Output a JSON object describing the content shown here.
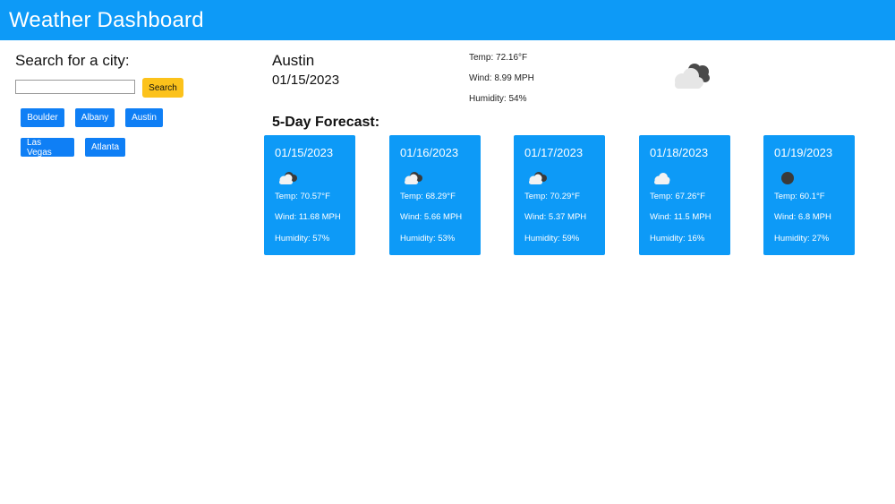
{
  "header": {
    "title": "Weather Dashboard"
  },
  "search": {
    "heading": "Search for a city:",
    "input_value": "",
    "button_label": "Search",
    "history": [
      "Boulder",
      "Albany",
      "Austin",
      "Las Vegas",
      "Atlanta"
    ]
  },
  "current": {
    "city": "Austin",
    "date": "01/15/2023",
    "temp": "Temp: 72.16°F",
    "wind": "Wind: 8.99 MPH",
    "humidity": "Humidity: 54%",
    "icon": "broken-clouds-icon"
  },
  "forecast": {
    "heading": "5-Day Forecast:",
    "days": [
      {
        "date": "01/15/2023",
        "icon": "partly-cloudy-icon",
        "temp": "Temp: 70.57°F",
        "wind": "Wind: 11.68 MPH",
        "humidity": "Humidity: 57%"
      },
      {
        "date": "01/16/2023",
        "icon": "partly-cloudy-icon",
        "temp": "Temp: 68.29°F",
        "wind": "Wind: 5.66 MPH",
        "humidity": "Humidity: 53%"
      },
      {
        "date": "01/17/2023",
        "icon": "partly-cloudy-icon",
        "temp": "Temp: 70.29°F",
        "wind": "Wind: 5.37 MPH",
        "humidity": "Humidity: 59%"
      },
      {
        "date": "01/18/2023",
        "icon": "cloud-icon",
        "temp": "Temp: 67.26°F",
        "wind": "Wind: 11.5 MPH",
        "humidity": "Humidity: 16%"
      },
      {
        "date": "01/19/2023",
        "icon": "dark-circle-icon",
        "temp": "Temp: 60.1°F",
        "wind": "Wind: 6.8 MPH",
        "humidity": "Humidity: 27%"
      }
    ]
  },
  "colors": {
    "header_bg": "#0d9af7",
    "card_bg": "#0d9af7",
    "city_button_bg": "#0f7ff5",
    "search_button_bg": "#fcc21b"
  }
}
